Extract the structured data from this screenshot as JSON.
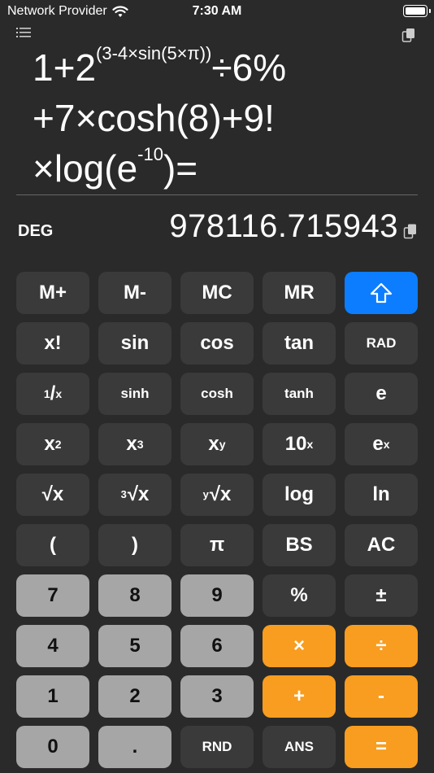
{
  "status": {
    "provider": "Network Provider",
    "time": "7:30 AM"
  },
  "expression": {
    "line1_base": "1+2",
    "line1_exp": "(3-4×sin(5×π))",
    "line1_tail": "÷6%",
    "line2": "+7×cosh(8)+9!",
    "line3_pre": "×log(e",
    "line3_exp": "-10",
    "line3_post": ")="
  },
  "display": {
    "mode": "DEG",
    "result": "978116.715943"
  },
  "keys": {
    "mplus": "M+",
    "mminus": "M-",
    "mc": "MC",
    "mr": "MR",
    "shift_icon": "shift-arrow-icon",
    "fact": "x!",
    "sin": "sin",
    "cos": "cos",
    "tan": "tan",
    "rad": "RAD",
    "recip_one": "1",
    "recip_slash": "/",
    "recip_x": "x",
    "sinh": "sinh",
    "cosh": "cosh",
    "tanh": "tanh",
    "e": "e",
    "sq_base": "x",
    "sq_exp": "2",
    "cube_base": "x",
    "cube_exp": "3",
    "pow_base": "x",
    "pow_exp": "y",
    "ten_base": "10",
    "ten_exp": "x",
    "exp_base": "e",
    "exp_exp": "x",
    "sqrt": "√x",
    "cbrt_pre": "3",
    "cbrt": "√x",
    "yroot_pre": "y",
    "yroot": "√x",
    "log": "log",
    "ln": "ln",
    "lparen": "(",
    "rparen": ")",
    "pi": "π",
    "bs": "BS",
    "ac": "AC",
    "n7": "7",
    "n8": "8",
    "n9": "9",
    "pct": "%",
    "plusminus": "±",
    "n4": "4",
    "n5": "5",
    "n6": "6",
    "mul": "×",
    "div": "÷",
    "n1": "1",
    "n2": "2",
    "n3": "3",
    "add": "+",
    "sub": "-",
    "n0": "0",
    "dot": ".",
    "rnd": "RND",
    "ans": "ANS",
    "eq": "="
  },
  "colors": {
    "background": "#2a2a2a",
    "key_dark": "#3a3a3a",
    "key_light": "#a6a6a6",
    "operator": "#f89d1f",
    "shift": "#0c7dff"
  }
}
